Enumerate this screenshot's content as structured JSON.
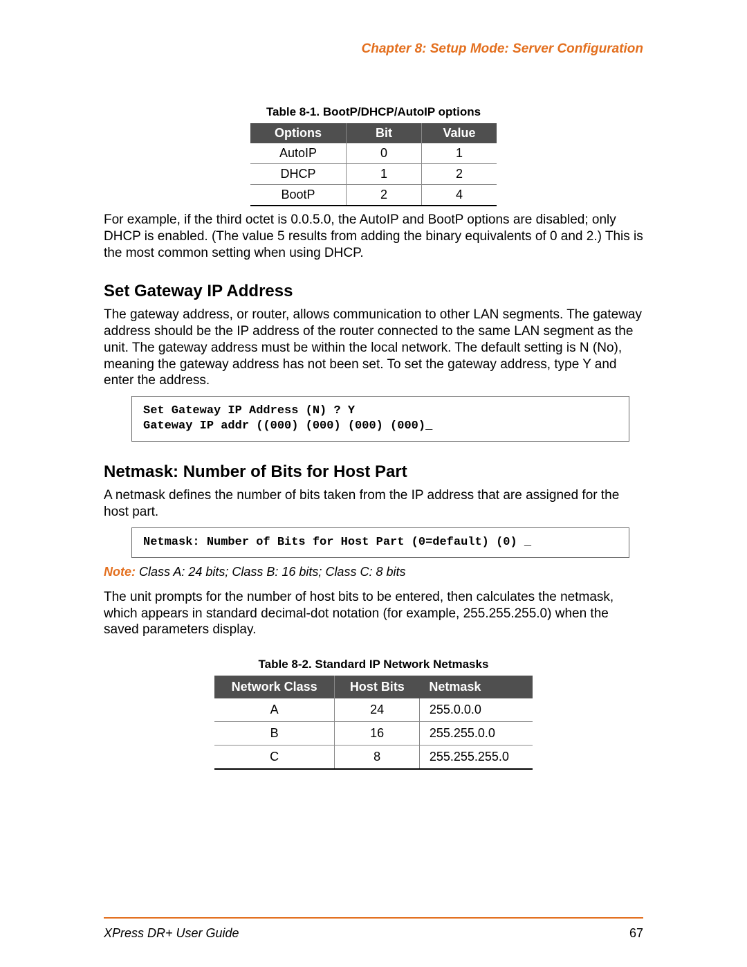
{
  "header": {
    "chapter": "Chapter 8: Setup Mode: Server Configuration"
  },
  "table1": {
    "caption": "Table 8-1. BootP/DHCP/AutoIP options",
    "headers": {
      "c1": "Options",
      "c2": "Bit",
      "c3": "Value"
    },
    "rows": [
      {
        "c1": "AutoIP",
        "c2": "0",
        "c3": "1"
      },
      {
        "c1": "DHCP",
        "c2": "1",
        "c3": "2"
      },
      {
        "c1": "BootP",
        "c2": "2",
        "c3": "4"
      }
    ]
  },
  "paragraphs": {
    "p1": "For example, if the third octet is 0.0.5.0, the AutoIP and BootP options are disabled; only DHCP is enabled. (The value 5 results from adding the binary equivalents of 0 and 2.) This is the most common setting when using DHCP.",
    "h2a": "Set Gateway IP Address",
    "p2": "The gateway address, or router, allows communication to other LAN segments. The gateway address should be the IP address of the router connected to the same LAN segment as the unit. The gateway address must be within the local network. The default setting is N (No), meaning the gateway address has not been set. To set the gateway address, type Y and enter the address.",
    "term1": "Set Gateway IP Address (N) ? Y\nGateway IP addr ((000) (000) (000) (000)_",
    "h2b": "Netmask: Number of Bits for Host Part",
    "p3": "A netmask defines the number of bits taken from the IP address that are assigned for the host part.",
    "term2": "Netmask: Number of Bits for Host Part (0=default) (0) _",
    "note_label": "Note:",
    "note_text": " Class A: 24 bits; Class B: 16 bits; Class C: 8 bits",
    "p4": "The unit prompts for the number of host bits to be entered, then calculates the netmask, which appears in standard decimal-dot notation (for example, 255.255.255.0) when the saved parameters display."
  },
  "table2": {
    "caption": "Table 8-2. Standard IP Network Netmasks",
    "headers": {
      "c1": "Network Class",
      "c2": "Host Bits",
      "c3": "Netmask"
    },
    "rows": [
      {
        "c1": "A",
        "c2": "24",
        "c3": "255.0.0.0"
      },
      {
        "c1": "B",
        "c2": "16",
        "c3": "255.255.0.0"
      },
      {
        "c1": "C",
        "c2": "8",
        "c3": "255.255.255.0"
      }
    ]
  },
  "footer": {
    "guide": "XPress DR+ User Guide",
    "page": "67"
  }
}
